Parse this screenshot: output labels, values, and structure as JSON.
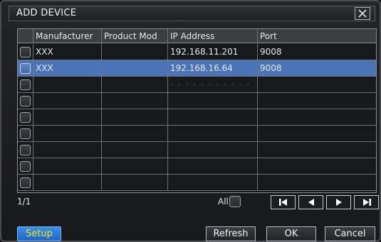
{
  "dialog": {
    "title": "ADD DEVICE",
    "close_label": "X"
  },
  "table": {
    "headers": [
      "Manufacturer",
      "Product Mod",
      "IP Address",
      "Port"
    ],
    "rows": [
      {
        "manufacturer": "XXX",
        "product_model": "",
        "ip": "192.168.11.201",
        "port": "9008",
        "selected": false
      },
      {
        "manufacturer": "XXX",
        "product_model": "",
        "ip": "192.168.16.64",
        "port": "9008",
        "selected": true
      },
      {
        "manufacturer": "",
        "product_model": "",
        "ip": "",
        "port": "",
        "selected": false
      },
      {
        "manufacturer": "",
        "product_model": "",
        "ip": "",
        "port": "",
        "selected": false
      },
      {
        "manufacturer": "",
        "product_model": "",
        "ip": "",
        "port": "",
        "selected": false
      },
      {
        "manufacturer": "",
        "product_model": "",
        "ip": "",
        "port": "",
        "selected": false
      },
      {
        "manufacturer": "",
        "product_model": "",
        "ip": "",
        "port": "",
        "selected": false
      },
      {
        "manufacturer": "",
        "product_model": "",
        "ip": "",
        "port": "",
        "selected": false
      },
      {
        "manufacturer": "",
        "product_model": "",
        "ip": "",
        "port": "",
        "selected": false
      }
    ],
    "ghost_text": "- - - - - - - - - - -"
  },
  "footer": {
    "page_label": "1/1",
    "all_label": "All",
    "nav_icons": [
      "first-page-icon",
      "prev-page-icon",
      "next-page-icon",
      "last-page-icon"
    ]
  },
  "buttons": {
    "setup": "Setup",
    "refresh": "Refresh",
    "ok": "OK",
    "cancel": "Cancel"
  },
  "colors": {
    "selected_row": "#4a73b8",
    "setup_button": "#2f7ad8",
    "setup_text": "#f5e21a"
  }
}
